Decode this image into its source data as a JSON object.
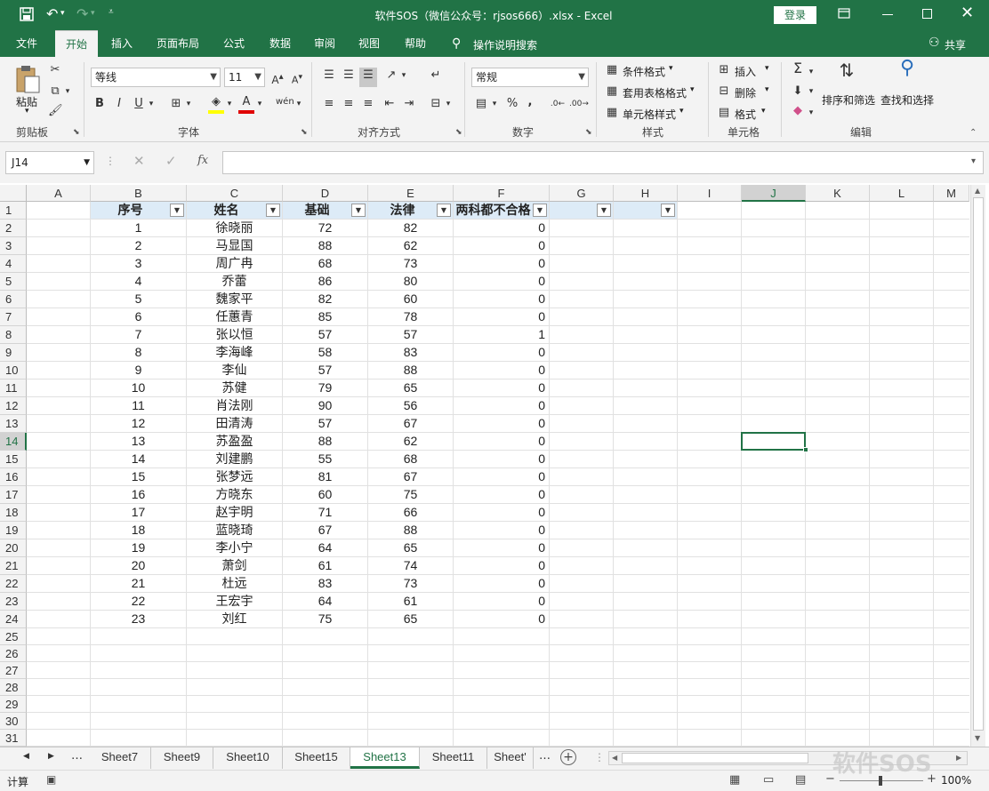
{
  "window": {
    "title": "软件SOS（微信公众号：rjsos666）.xlsx  -  Excel",
    "login_label": "登录"
  },
  "ribbon_tabs": [
    "文件",
    "开始",
    "插入",
    "页面布局",
    "公式",
    "数据",
    "审阅",
    "视图",
    "帮助"
  ],
  "tell_me": "操作说明搜索",
  "share_label": "共享",
  "clipboard": {
    "paste_label": "粘贴",
    "group_label": "剪贴板"
  },
  "font": {
    "name": "等线",
    "size": "11",
    "group_label": "字体",
    "bold": "B",
    "italic": "I",
    "underline": "U",
    "phonetic": "wén"
  },
  "alignment": {
    "group_label": "对齐方式"
  },
  "number": {
    "format": "常规",
    "group_label": "数字",
    "percent": "%",
    "comma": ","
  },
  "styles": {
    "conditional": "条件格式",
    "table": "套用表格格式",
    "cell_styles": "单元格样式",
    "group_label": "样式"
  },
  "cells": {
    "insert": "插入",
    "delete": "删除",
    "format": "格式",
    "group_label": "单元格"
  },
  "editing": {
    "sort_filter": "排序和筛选",
    "find_select": "查找和选择",
    "group_label": "编辑"
  },
  "formula_bar": {
    "name_box": "J14",
    "fx": "fx",
    "content": ""
  },
  "columns": [
    "A",
    "B",
    "C",
    "D",
    "E",
    "F",
    "G",
    "H",
    "I",
    "J",
    "K",
    "L",
    "M"
  ],
  "selected_column": "J",
  "selected_row": 14,
  "row_numbers": [
    1,
    2,
    3,
    4,
    5,
    6,
    7,
    8,
    9,
    10,
    11,
    12,
    13,
    14,
    15,
    16,
    17,
    18,
    19,
    20,
    21,
    22,
    23,
    24,
    25,
    26,
    27,
    28,
    29,
    30,
    31
  ],
  "table": {
    "headers": [
      "序号",
      "姓名",
      "基础",
      "法律",
      "两科都不合格"
    ],
    "rows": [
      [
        "1",
        "徐晓丽",
        "72",
        "82",
        "0"
      ],
      [
        "2",
        "马显国",
        "88",
        "62",
        "0"
      ],
      [
        "3",
        "周广冉",
        "68",
        "73",
        "0"
      ],
      [
        "4",
        "乔蕾",
        "86",
        "80",
        "0"
      ],
      [
        "5",
        "魏家平",
        "82",
        "60",
        "0"
      ],
      [
        "6",
        "任蕙青",
        "85",
        "78",
        "0"
      ],
      [
        "7",
        "张以恒",
        "57",
        "57",
        "1"
      ],
      [
        "8",
        "李海峰",
        "58",
        "83",
        "0"
      ],
      [
        "9",
        "李仙",
        "57",
        "88",
        "0"
      ],
      [
        "10",
        "苏健",
        "79",
        "65",
        "0"
      ],
      [
        "11",
        "肖法刚",
        "90",
        "56",
        "0"
      ],
      [
        "12",
        "田清涛",
        "57",
        "67",
        "0"
      ],
      [
        "13",
        "苏盈盈",
        "88",
        "62",
        "0"
      ],
      [
        "14",
        "刘建鹏",
        "55",
        "68",
        "0"
      ],
      [
        "15",
        "张梦远",
        "81",
        "67",
        "0"
      ],
      [
        "16",
        "方晓东",
        "60",
        "75",
        "0"
      ],
      [
        "17",
        "赵宇明",
        "71",
        "66",
        "0"
      ],
      [
        "18",
        "蓝晓琦",
        "67",
        "88",
        "0"
      ],
      [
        "19",
        "李小宁",
        "64",
        "65",
        "0"
      ],
      [
        "20",
        "萧剑",
        "61",
        "74",
        "0"
      ],
      [
        "21",
        "杜远",
        "83",
        "73",
        "0"
      ],
      [
        "22",
        "王宏宇",
        "64",
        "61",
        "0"
      ],
      [
        "23",
        "刘红",
        "75",
        "65",
        "0"
      ]
    ]
  },
  "sheet_tabs": [
    "Sheet7",
    "Sheet9",
    "Sheet10",
    "Sheet15",
    "Sheet13",
    "Sheet11",
    "Sheet'"
  ],
  "active_sheet": "Sheet13",
  "status": {
    "mode": "计算",
    "zoom": "100%"
  },
  "watermark": "软件SOS",
  "colors": {
    "accent": "#217346",
    "header_fill": "#ddebf7"
  }
}
